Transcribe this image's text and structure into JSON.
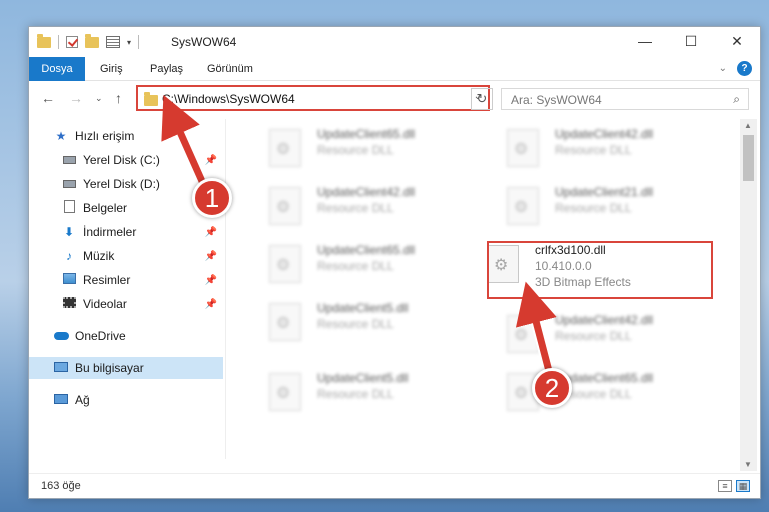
{
  "window": {
    "title": "SysWOW64"
  },
  "window_controls": {
    "minimize": "—",
    "maximize": "☐",
    "close": "✕"
  },
  "ribbon": {
    "tabs": [
      "Dosya",
      "Giriş",
      "Paylaş",
      "Görünüm"
    ]
  },
  "address": {
    "path": "C:\\Windows\\SysWOW64"
  },
  "search": {
    "placeholder": "Ara: SysWOW64"
  },
  "sidebar": {
    "items": [
      {
        "label": "Hızlı erişim",
        "icon": "star-icon"
      },
      {
        "label": "Yerel Disk (C:)",
        "icon": "drive-icon",
        "pinned": true
      },
      {
        "label": "Yerel Disk (D:)",
        "icon": "drive-icon",
        "pinned": false
      },
      {
        "label": "Belgeler",
        "icon": "document-icon",
        "pinned": false
      },
      {
        "label": "İndirmeler",
        "icon": "download-icon",
        "pinned": true
      },
      {
        "label": "Müzik",
        "icon": "music-icon",
        "pinned": true
      },
      {
        "label": "Resimler",
        "icon": "pictures-icon",
        "pinned": true
      },
      {
        "label": "Videolar",
        "icon": "video-icon",
        "pinned": true
      },
      {
        "label": "OneDrive",
        "icon": "cloud-icon"
      },
      {
        "label": "Bu bilgisayar",
        "icon": "computer-icon",
        "selected": true
      },
      {
        "label": "Ağ",
        "icon": "network-icon"
      }
    ]
  },
  "files": [
    {
      "name": "UpdateClient65.dll",
      "sub": "Resource DLL"
    },
    {
      "name": "UpdateClient42.dll",
      "sub": "Resource DLL"
    },
    {
      "name": "UpdateClient42.dll",
      "sub": "Resource DLL"
    },
    {
      "name": "UpdateClient21.dll",
      "sub": "Resource DLL"
    },
    {
      "name": "UpdateClient65.dll",
      "sub": "Resource DLL"
    },
    {
      "name": "crlfx3d100.dll",
      "sub": "10.410.0.0",
      "sub2": "3D Bitmap Effects",
      "highlighted": true
    },
    {
      "name": "UpdateClient5.dll",
      "sub": "Resource DLL"
    },
    {
      "name": "UpdateClient42.dll",
      "sub": "Resource DLL"
    },
    {
      "name": "UpdateClient5.dll",
      "sub": "Resource DLL"
    },
    {
      "name": "UpdateClient65.dll",
      "sub": "Resource DLL"
    }
  ],
  "status": {
    "count": "163 öğe"
  },
  "annotations": {
    "badge1": "1",
    "badge2": "2"
  },
  "colors": {
    "accent": "#1979ca",
    "highlight": "#d9453b"
  }
}
